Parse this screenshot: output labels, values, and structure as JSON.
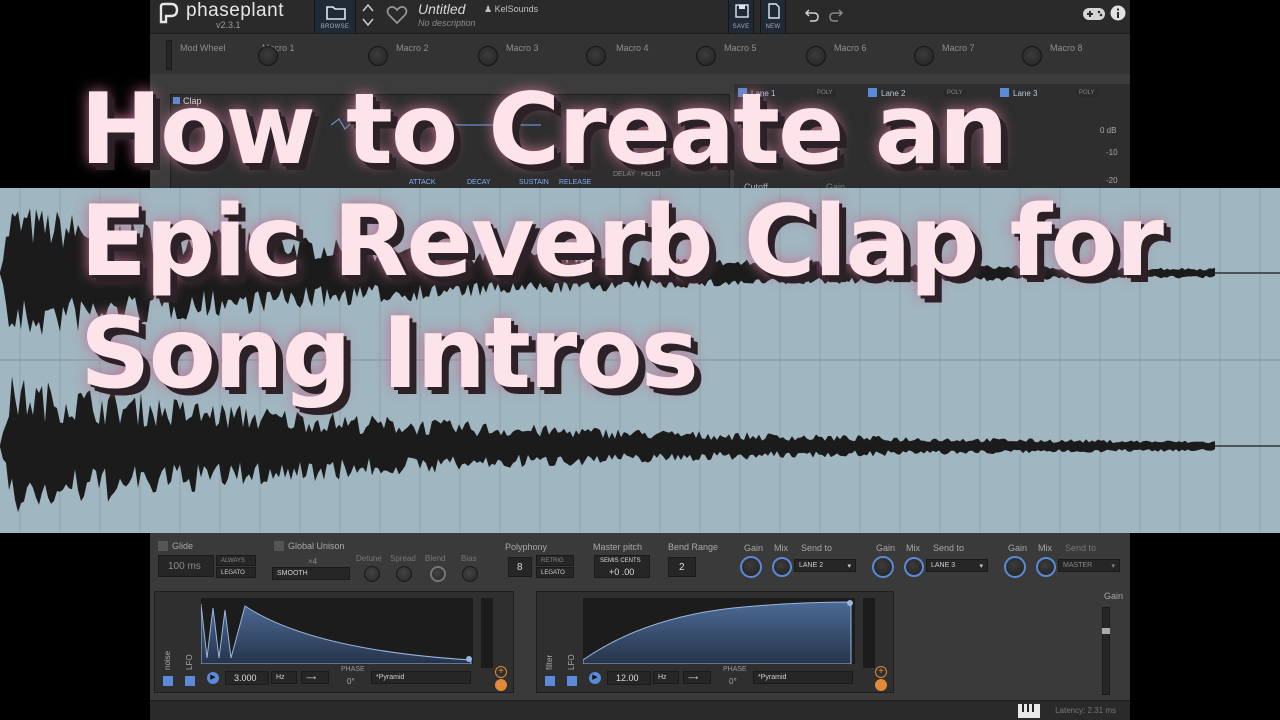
{
  "header": {
    "app_name": "phaseplant",
    "version": "v2.3.1",
    "browse_label": "BROWSE",
    "save_label": "SAVE",
    "new_label": "NEW",
    "preset_title": "Untitled",
    "preset_description": "No description",
    "author": "KelSounds"
  },
  "macros": {
    "mod_wheel": "Mod Wheel",
    "items": [
      "Macro 1",
      "Macro 2",
      "Macro 3",
      "Macro 4",
      "Macro 5",
      "Macro 6",
      "Macro 7",
      "Macro 8"
    ]
  },
  "generator": {
    "name": "Clap",
    "attack": "ATTACK",
    "decay": "DECAY",
    "sustain": "SUSTAIN",
    "release": "RELEASE",
    "delay": "DELAY",
    "hold": "HOLD",
    "cutoff": "Cutoff",
    "gain": "Gain"
  },
  "lanes": [
    {
      "name": "Lane 1",
      "poly": "POLY"
    },
    {
      "name": "Lane 2",
      "poly": "POLY"
    },
    {
      "name": "Lane 3",
      "poly": "POLY"
    }
  ],
  "meter": {
    "db0": "0 dB",
    "db10": "-10",
    "db20": "-20"
  },
  "title_overlay": {
    "line1": "How to Create an",
    "line2": "Epic Reverb Clap for",
    "line3": "Song Intros"
  },
  "bottom": {
    "glide": {
      "label": "Glide",
      "value": "100 ms",
      "always": "ALWAYS",
      "legato": "LEGATO"
    },
    "global_unison": {
      "label": "Global Unison",
      "voices": "×4",
      "mode": "SMOOTH",
      "detune": "Detune",
      "spread": "Spread",
      "blend": "Blend",
      "bias": "Bias"
    },
    "polyphony": {
      "label": "Polyphony",
      "value": "8",
      "retrig": "RETRIG",
      "legato": "LEGATO"
    },
    "master_pitch": {
      "label": "Master pitch",
      "units": "SEMIS CENTS",
      "value": "+0 .00"
    },
    "bend_range": {
      "label": "Bend Range",
      "value": "2"
    },
    "lane_outputs": [
      {
        "gain": "Gain",
        "mix": "Mix",
        "send_to": "Send to",
        "target": "LANE 2"
      },
      {
        "gain": "Gain",
        "mix": "Mix",
        "send_to": "Send to",
        "target": "LANE 3"
      },
      {
        "gain": "Gain",
        "mix": "Mix",
        "send_to": "Send to",
        "target": "MASTER"
      }
    ],
    "master_gain": "Gain"
  },
  "lfo_panels": [
    {
      "tag": "noise",
      "lfo": "LFO",
      "rate": "3.000",
      "unit": "Hz",
      "phase_label": "PHASE",
      "phase": "0°",
      "shape": "*Pyramid"
    },
    {
      "tag": "filter",
      "lfo": "LFO",
      "rate": "12.00",
      "unit": "Hz",
      "phase_label": "PHASE",
      "phase": "0°",
      "shape": "*Pyramid"
    }
  ],
  "footer": {
    "latency": "Latency: 2.31 ms"
  },
  "colors": {
    "accent": "#5a8ad8",
    "title_fill": "#fde4ea",
    "wave_bg": "#a0b6c0",
    "wave": "#1b1b1b"
  }
}
